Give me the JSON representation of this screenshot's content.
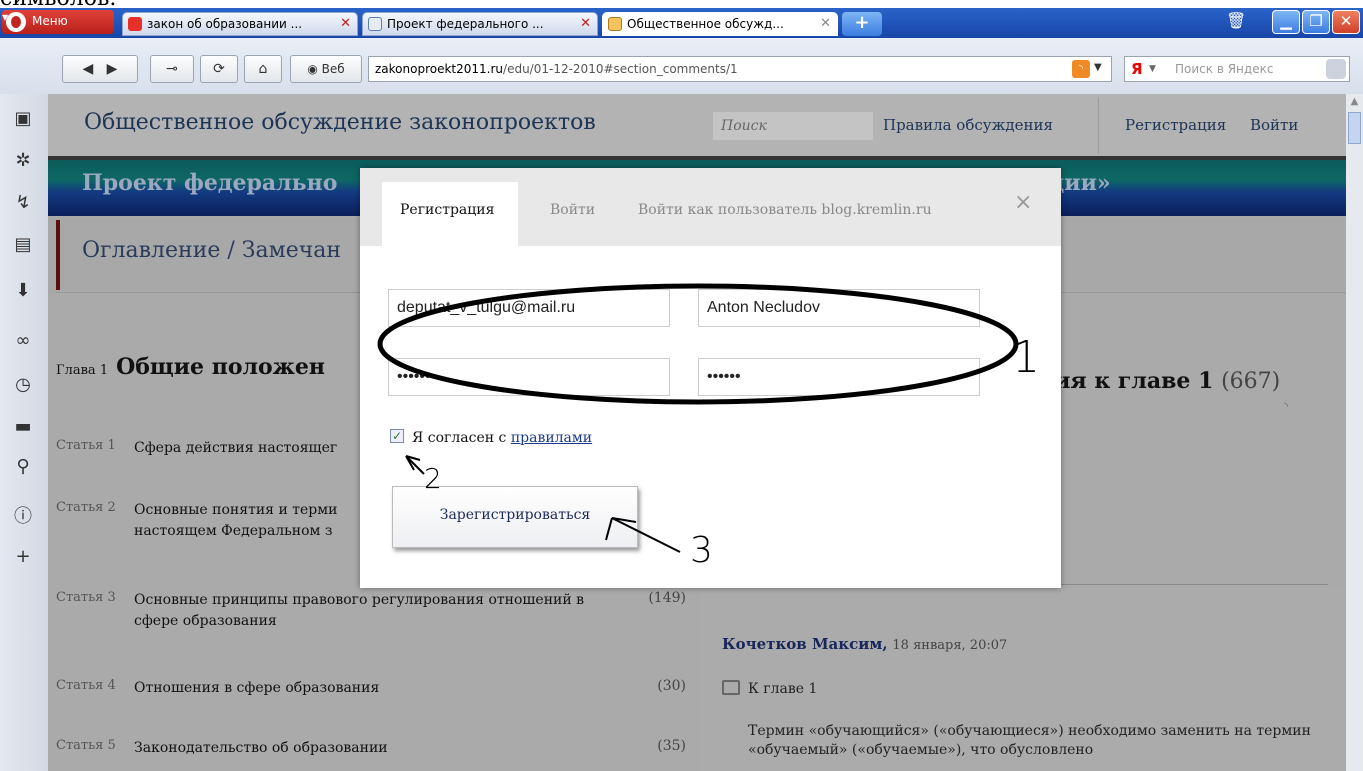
{
  "top_crop_text": "символов.",
  "browser": {
    "menu_label": "Меню",
    "tabs": [
      {
        "title": "закон об образовании ...",
        "favicon": "yandex-favicon"
      },
      {
        "title": "Проект федерального ...",
        "favicon": "document-favicon"
      },
      {
        "title": "Общественное обсужд...",
        "favicon": "page-favicon"
      }
    ],
    "new_tab": "+",
    "web_label": "Веб",
    "address_host": "zakonoproekt2011.ru",
    "address_path": "/edu/01-12-2010#section_comments/1",
    "search_logo": "Я",
    "search_placeholder": "Поиск в Яндекс"
  },
  "site": {
    "title": "Общественное обсуждение законопроектов",
    "search_placeholder": "Поиск",
    "nav": [
      "Правила обсуждения",
      "Регистрация",
      "Войти"
    ],
    "project_title_start": "Проект федерально",
    "project_title_end": "ции»",
    "toc_title": "Оглавление / Замечан",
    "chapter_num": "Глава 1",
    "chapter_name": "Общие положен",
    "articles": [
      {
        "num": "Статья 1",
        "title": "Сфера действия настоящег",
        "count": ""
      },
      {
        "num": "Статья 2",
        "title": "Основные понятия и терми настоящем Федеральном з",
        "count": ""
      },
      {
        "num": "Статья 3",
        "title": "Основные принципы правового регулирования отношений в сфере образования",
        "count": "(149)"
      },
      {
        "num": "Статья 4",
        "title": "Отношения в сфере образования",
        "count": "(30)"
      },
      {
        "num": "Статья 5",
        "title": "Законодательство об образовании",
        "count": "(35)"
      }
    ],
    "comments_heading": "ния к главе 1",
    "comments_count": "(667)",
    "comment": {
      "author": "Кочетков Максим,",
      "date": "18 января, 20:07",
      "chapter_link": "К главе 1",
      "text": "Термин «обучающийся» («обучающиеся») необходимо заменить на термин «обучаемый» («обучаемые»), что обусловлено"
    }
  },
  "modal": {
    "tabs": [
      "Регистрация",
      "Войти",
      "Войти как пользователь blog.kremlin.ru"
    ],
    "close": "×",
    "email_value": "deputat_v_tulgu@mail.ru",
    "name_value": "Anton Necludov",
    "password_value": "••••••",
    "password_confirm_value": "••••••",
    "checkbox_checked": true,
    "agree_text": "Я согласен с ",
    "agree_link": "правилами",
    "submit_label": "Зарегистрироваться"
  },
  "annotations": [
    "1",
    "2",
    "3"
  ]
}
